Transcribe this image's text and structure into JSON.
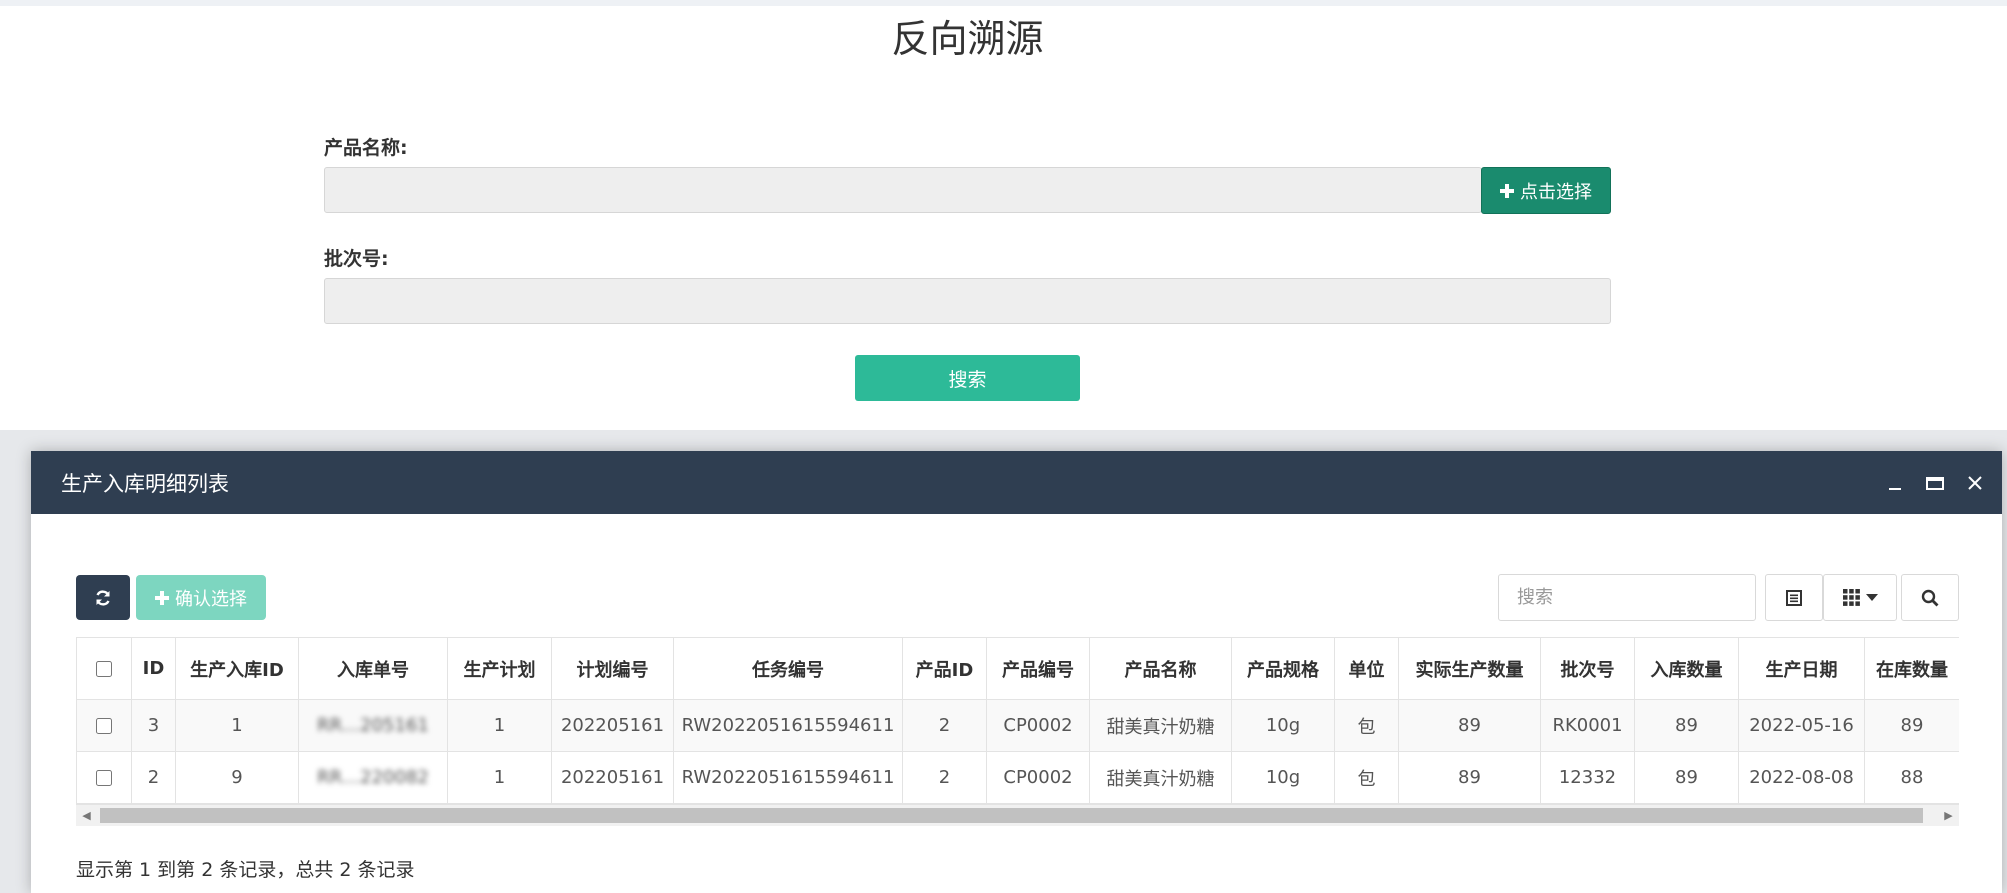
{
  "page": {
    "title": "反向溯源",
    "product_label": "产品名称:",
    "product_value": "",
    "select_button": "点击选择",
    "batch_label": "批次号:",
    "batch_value": "",
    "search_button": "搜索"
  },
  "modal": {
    "title": "生产入库明细列表",
    "confirm_button": "确认选择",
    "search_placeholder": "搜索",
    "columns": [
      "ID",
      "生产入库ID",
      "入库单号",
      "生产计划",
      "计划编号",
      "任务编号",
      "产品ID",
      "产品编号",
      "产品名称",
      "产品规格",
      "单位",
      "实际生产数量",
      "批次号",
      "入库数量",
      "生产日期",
      "在库数量"
    ],
    "rows": [
      {
        "id": "3",
        "in_id": "1",
        "in_no": "RR…205161",
        "plan": "1",
        "plan_no": "202205161",
        "task_no": "RW2022051615594611",
        "product_id": "2",
        "product_code": "CP0002",
        "product_name": "甜美真汁奶糖",
        "spec": "10g",
        "unit": "包",
        "actual_qty": "89",
        "batch": "RK0001",
        "in_qty": "89",
        "date": "2022-05-16",
        "stock_qty": "89"
      },
      {
        "id": "2",
        "in_id": "9",
        "in_no": "RR…220082",
        "plan": "1",
        "plan_no": "202205161",
        "task_no": "RW2022051615594611",
        "product_id": "2",
        "product_code": "CP0002",
        "product_name": "甜美真汁奶糖",
        "spec": "10g",
        "unit": "包",
        "actual_qty": "89",
        "batch": "12332",
        "in_qty": "89",
        "date": "2022-08-08",
        "stock_qty": "88"
      }
    ],
    "footer": "显示第 1 到第 2 条记录，总共 2 条记录"
  },
  "colors": {
    "modal_header": "#2f3e51",
    "select_button": "#1a8b6e",
    "search_button": "#2dba98",
    "confirm_button": "#7dd6c0"
  },
  "icons": [
    "plus-icon",
    "refresh-icon",
    "minimize-icon",
    "maximize-icon",
    "close-icon",
    "list-view-icon",
    "columns-grid-icon",
    "caret-down-icon",
    "search-icon",
    "arrow-left-icon",
    "arrow-right-icon"
  ]
}
